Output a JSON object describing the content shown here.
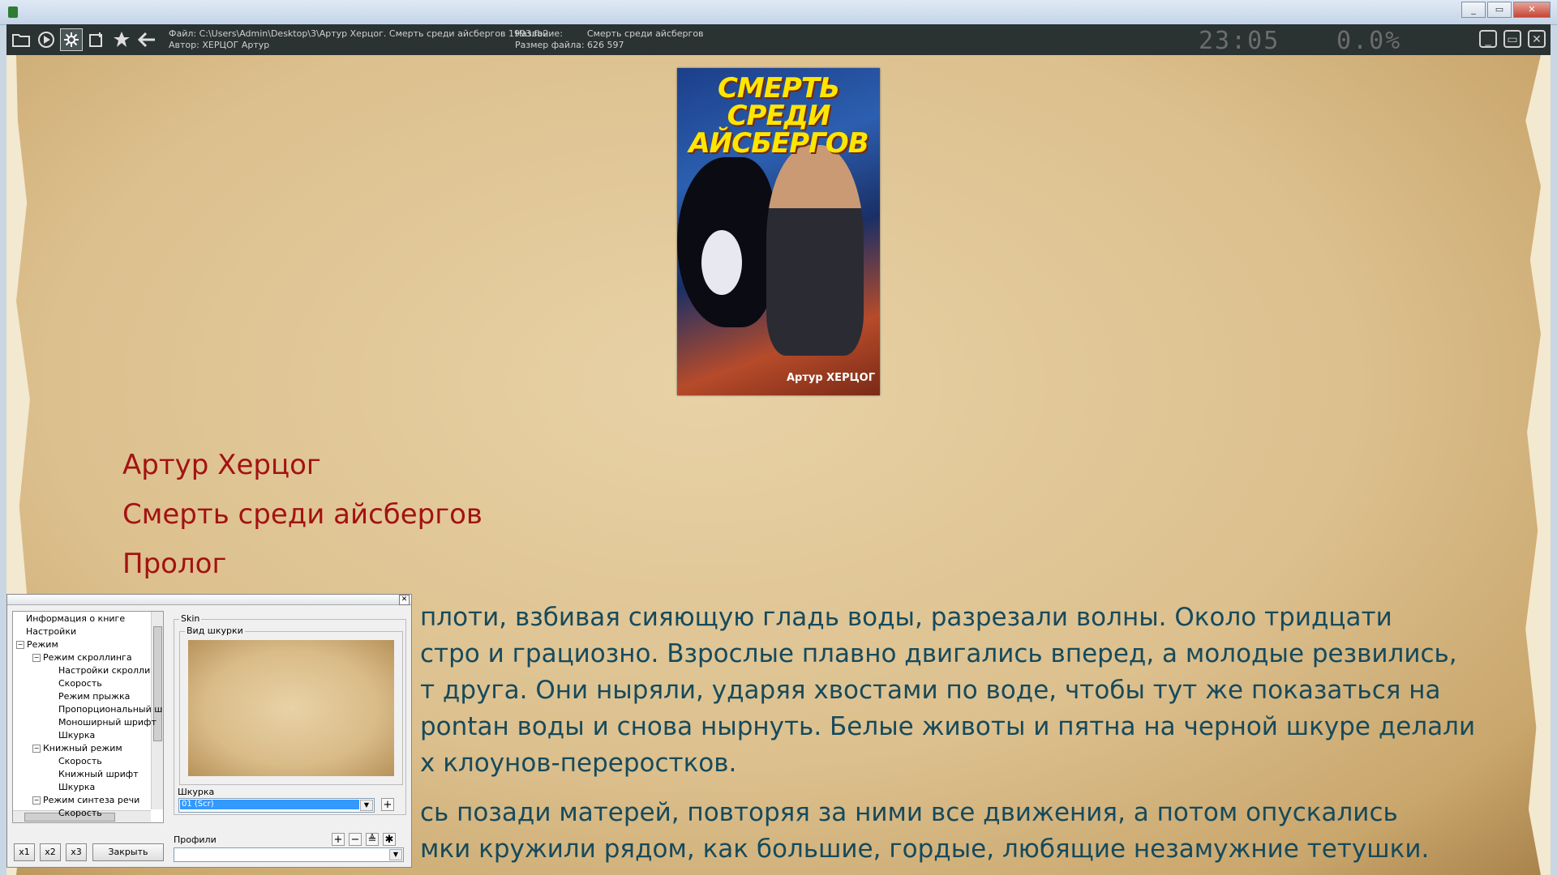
{
  "window": {
    "controls": [
      "_",
      "▭",
      "✕"
    ]
  },
  "toolbar": {
    "icons": [
      "folder-icon",
      "play-icon",
      "settings-icon",
      "add-bookmark-icon",
      "star-icon",
      "back-arrow-icon"
    ],
    "file_line": "Файл: C:\\Users\\Admin\\Desktop\\3\\Артур Херцог. Смерть среди айсбергов 1993.fb2",
    "author_line": "Автор: ХЕРЦОГ Артур",
    "title_label": "Название:",
    "title_value": "Смерть среди айсбергов",
    "size_line": "Размер файла: 626 597",
    "clock": "23:05",
    "percent": "0.0%"
  },
  "book": {
    "cover_title": "СМЕРТЬ СРЕДИ АЙСБЕРГОВ",
    "cover_author": "Артур ХЕРЦОГ",
    "heading_author": "Артур Херцог",
    "heading_title": "Смерть среди айсбергов",
    "heading_chapter": "Пролог",
    "para1": [
      "плоти, взбивая сияющую гладь воды, разрезали волны. Около тридцати",
      "стро и грациозно. Взрослые плавно двигались вперед, а молодые резвились,",
      "т друга. Они ныряли, ударяя хвостами по воде, чтобы тут же показаться на",
      "рontан воды и снова нырнуть. Белые животы и пятна на черной шкуре делали",
      "х клоунов-переростков."
    ],
    "para2": [
      "сь позади матерей, повторяя за ними все движения, а потом опускались",
      "мки кружили рядом, как большие, гордые, любящие незамужние тетушки."
    ]
  },
  "dialog": {
    "tree": [
      {
        "label": "Информация о книге",
        "level": 0,
        "toggle": ""
      },
      {
        "label": "Настройки",
        "level": 0,
        "toggle": ""
      },
      {
        "label": "Режим",
        "level": 0,
        "toggle": "−"
      },
      {
        "label": "Режим скроллинга",
        "level": 1,
        "toggle": "−"
      },
      {
        "label": "Настройки скролли",
        "level": 2,
        "toggle": ""
      },
      {
        "label": "Скорость",
        "level": 2,
        "toggle": ""
      },
      {
        "label": "Режим прыжка",
        "level": 2,
        "toggle": ""
      },
      {
        "label": "Пропорциональный ш",
        "level": 2,
        "toggle": ""
      },
      {
        "label": "Моноширный шрифт",
        "level": 2,
        "toggle": ""
      },
      {
        "label": "Шкурка",
        "level": 2,
        "toggle": ""
      },
      {
        "label": "Книжный режим",
        "level": 1,
        "toggle": "−"
      },
      {
        "label": "Скорость",
        "level": 2,
        "toggle": ""
      },
      {
        "label": "Книжный шрифт",
        "level": 2,
        "toggle": ""
      },
      {
        "label": "Шкурка",
        "level": 2,
        "toggle": ""
      },
      {
        "label": "Режим синтеза речи",
        "level": 1,
        "toggle": "−"
      },
      {
        "label": "Скорость",
        "level": 2,
        "toggle": ""
      }
    ],
    "skin_group": "Skin",
    "skin_view_group": "Вид шкурки",
    "skin_label": "Шкурка",
    "skin_value": "01 (Scr)",
    "profiles_label": "Профили",
    "profile_value": "",
    "btn_x1": "x1",
    "btn_x2": "x2",
    "btn_x3": "x3",
    "btn_close": "Закрыть",
    "plus": "+",
    "minus": "−",
    "save": "≜",
    "gear": "✱"
  }
}
